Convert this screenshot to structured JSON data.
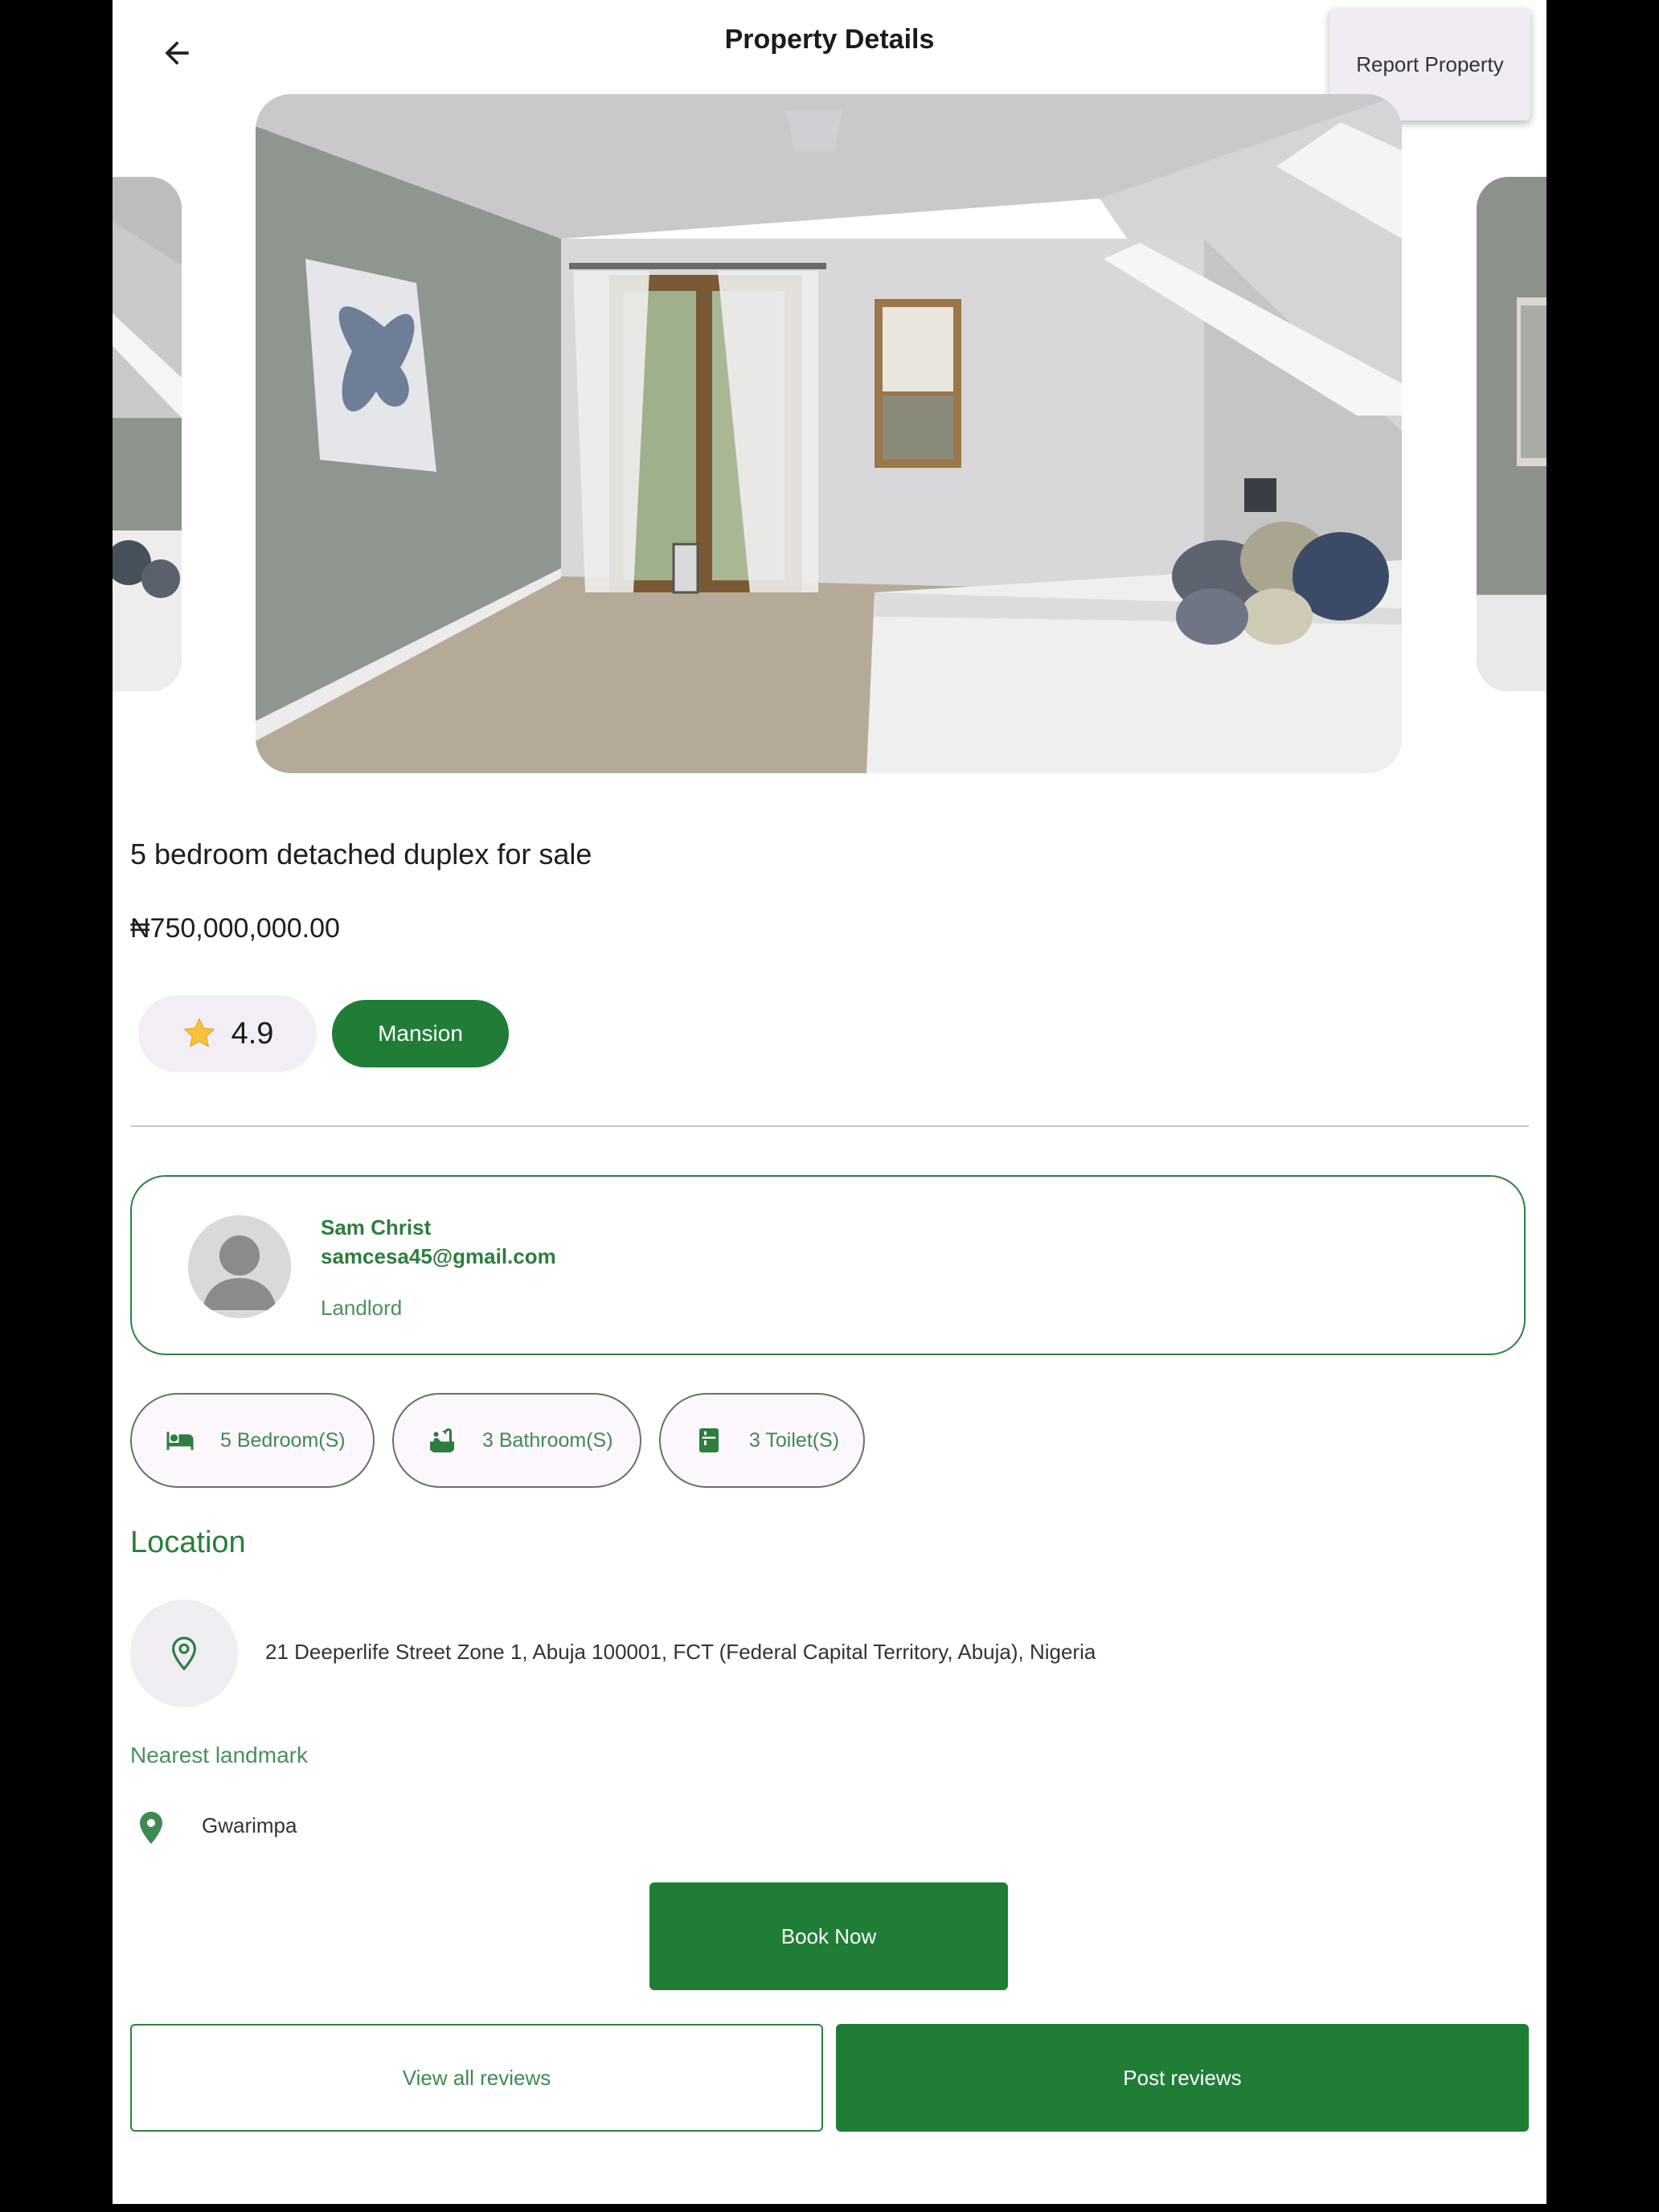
{
  "header": {
    "title": "Property Details",
    "back_icon": "arrow-left-icon",
    "menu_item": "Report Property"
  },
  "property": {
    "title": "5 bedroom detached duplex for sale",
    "price": "₦750,000,000.00",
    "rating": "4.9",
    "rating_icon": "star-icon",
    "type": "Mansion"
  },
  "owner": {
    "name": "Sam Christ",
    "email": "samcesa45@gmail.com",
    "role": "Landlord"
  },
  "features": [
    {
      "label": "5 Bedroom(S)",
      "icon": "bed-icon"
    },
    {
      "label": "3 Bathroom(S)",
      "icon": "bathtub-icon"
    },
    {
      "label": "3 Toilet(S)",
      "icon": "toilet-icon"
    }
  ],
  "location": {
    "heading": "Location",
    "address": "21 Deeperlife Street Zone 1, Abuja 100001, FCT (Federal Capital Territory, Abuja), Nigeria",
    "landmark_heading": "Nearest landmark",
    "landmark": "Gwarimpa"
  },
  "actions": {
    "book": "Book Now",
    "view_reviews": "View all reviews",
    "post_reviews": "Post reviews"
  },
  "colors": {
    "primary_green": "#1f7d36",
    "chip_bg": "#f3eef6"
  }
}
